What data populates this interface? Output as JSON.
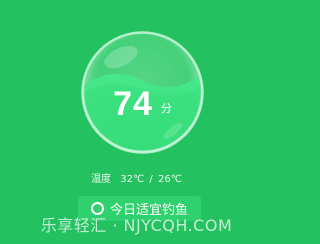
{
  "score": {
    "value": "74",
    "unit": "分"
  },
  "temperature": {
    "label": "温度",
    "low": "32℃",
    "separator": "/",
    "high": "26℃"
  },
  "verdict": {
    "text": "今日适宜钓鱼",
    "icon": "ring-icon"
  },
  "watermark": "乐享轻汇 · NJYCQH.COM",
  "colors": {
    "background": "#23c15f",
    "bubble_fill": "#3ee585",
    "badge": "#2fd06e",
    "text": "#ffffff"
  }
}
